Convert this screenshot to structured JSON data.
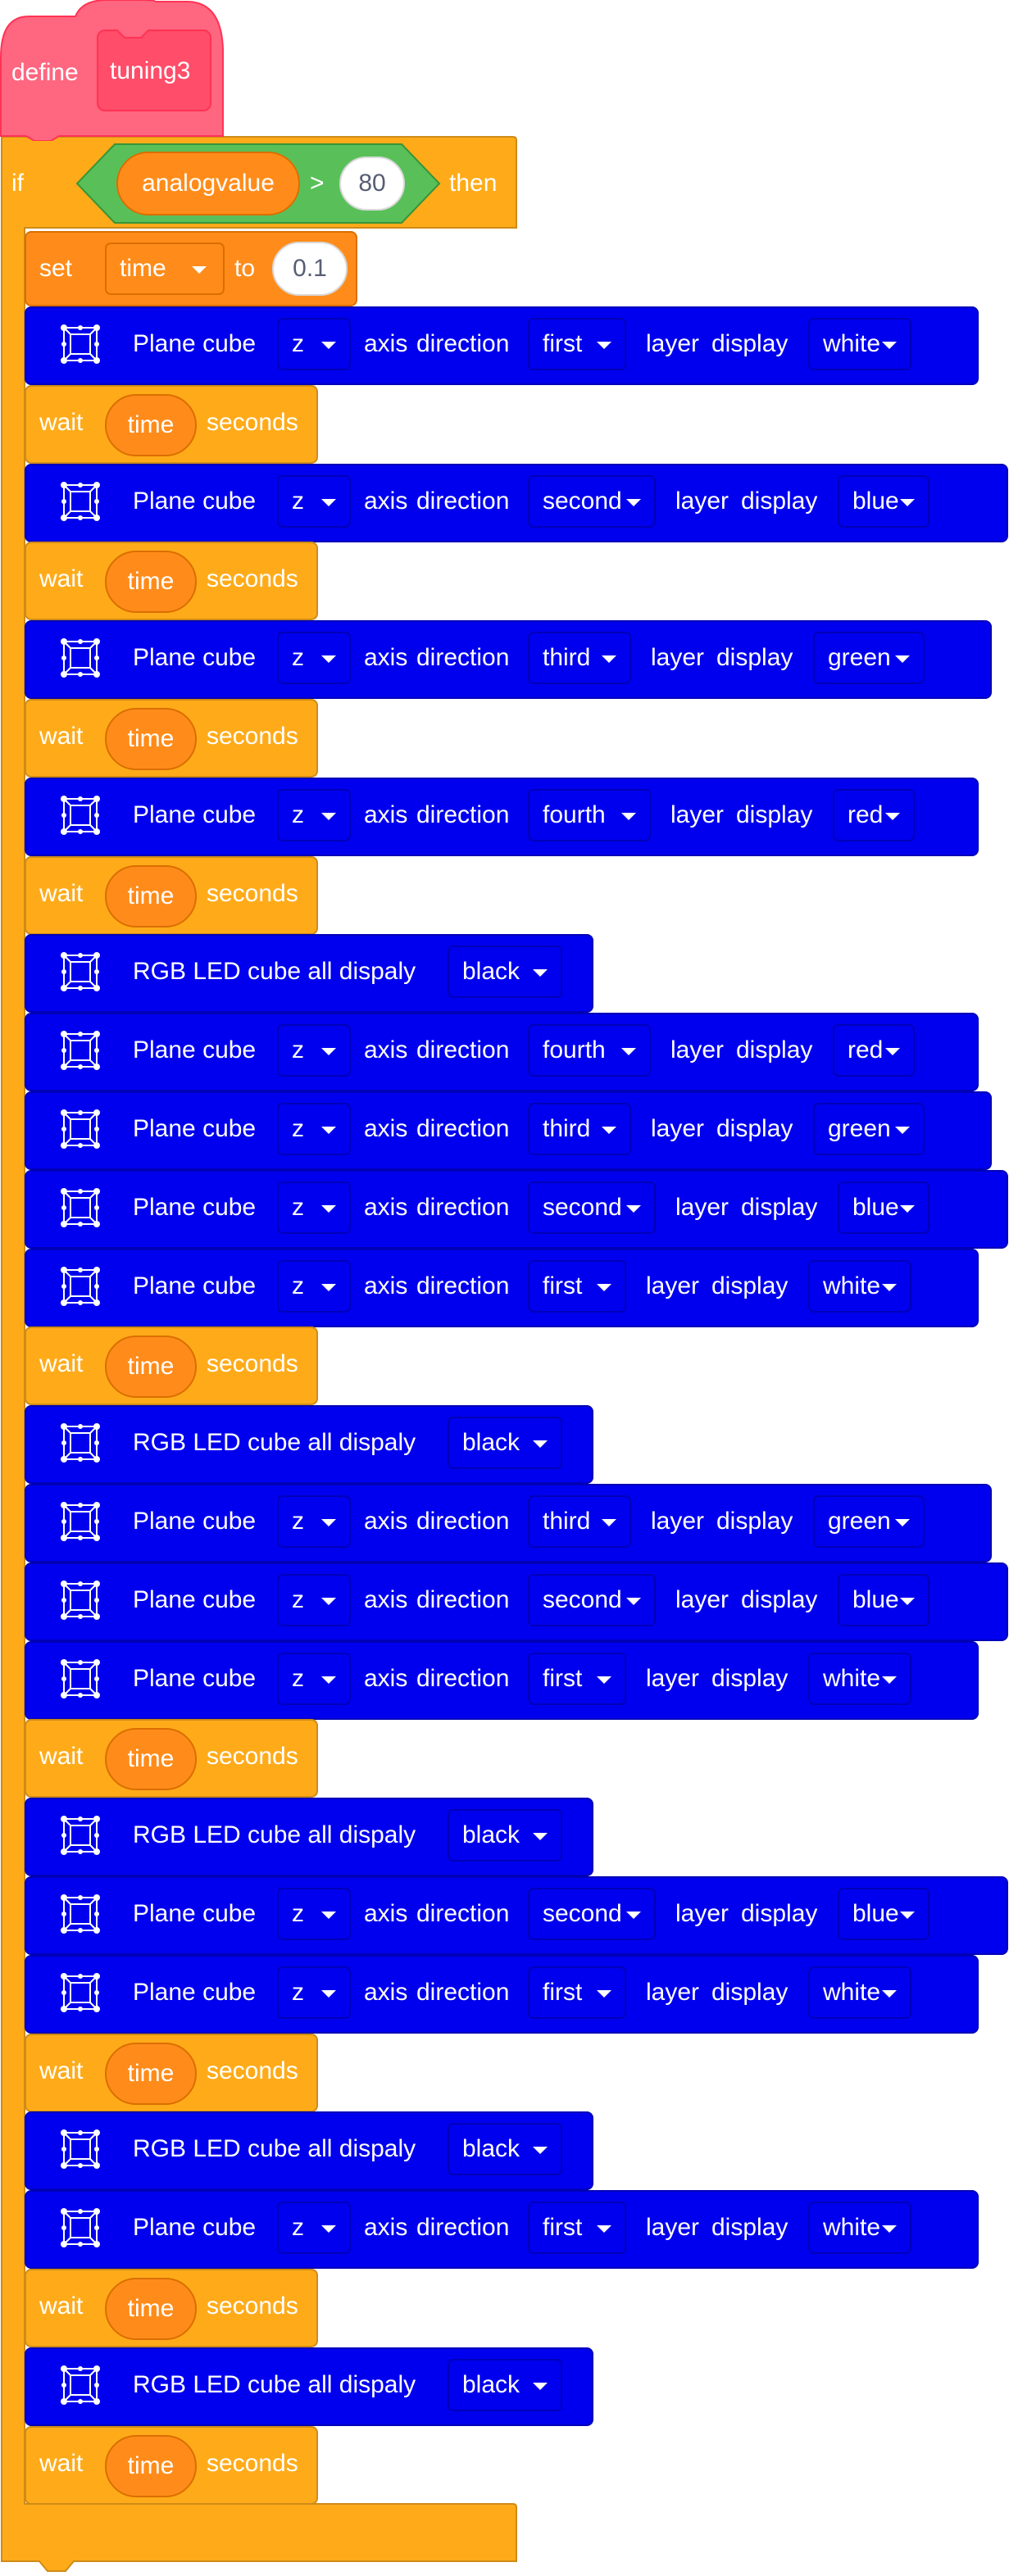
{
  "define": {
    "label": "define",
    "name": "tuning3"
  },
  "if_block": {
    "if_label": "if",
    "then_label": "then",
    "condition": {
      "variable": "analogvalue",
      "operator": ">",
      "value": "80"
    }
  },
  "set_block": {
    "set_label": "set",
    "variable": "time",
    "to_label": "to",
    "value": "0.1"
  },
  "labels": {
    "plane": "Plane cube",
    "axis": "axis",
    "direction": "direction",
    "layer": "layer",
    "display": "display",
    "rgb": "RGB LED cube all dispaly",
    "wait": "wait",
    "seconds": "seconds"
  },
  "wait_variable": "time",
  "blocks": [
    {
      "type": "plane",
      "axis": "z",
      "layer": "first",
      "color": "white"
    },
    {
      "type": "wait"
    },
    {
      "type": "plane",
      "axis": "z",
      "layer": "second",
      "color": "blue"
    },
    {
      "type": "wait"
    },
    {
      "type": "plane",
      "axis": "z",
      "layer": "third",
      "color": "green"
    },
    {
      "type": "wait"
    },
    {
      "type": "plane",
      "axis": "z",
      "layer": "fourth",
      "color": "red"
    },
    {
      "type": "wait"
    },
    {
      "type": "rgb",
      "color": "black"
    },
    {
      "type": "plane",
      "axis": "z",
      "layer": "fourth",
      "color": "red"
    },
    {
      "type": "plane",
      "axis": "z",
      "layer": "third",
      "color": "green"
    },
    {
      "type": "plane",
      "axis": "z",
      "layer": "second",
      "color": "blue"
    },
    {
      "type": "plane",
      "axis": "z",
      "layer": "first",
      "color": "white"
    },
    {
      "type": "wait"
    },
    {
      "type": "rgb",
      "color": "black"
    },
    {
      "type": "plane",
      "axis": "z",
      "layer": "third",
      "color": "green"
    },
    {
      "type": "plane",
      "axis": "z",
      "layer": "second",
      "color": "blue"
    },
    {
      "type": "plane",
      "axis": "z",
      "layer": "first",
      "color": "white"
    },
    {
      "type": "wait"
    },
    {
      "type": "rgb",
      "color": "black"
    },
    {
      "type": "plane",
      "axis": "z",
      "layer": "second",
      "color": "blue"
    },
    {
      "type": "plane",
      "axis": "z",
      "layer": "first",
      "color": "white"
    },
    {
      "type": "wait"
    },
    {
      "type": "rgb",
      "color": "black"
    },
    {
      "type": "plane",
      "axis": "z",
      "layer": "first",
      "color": "white"
    },
    {
      "type": "wait"
    },
    {
      "type": "rgb",
      "color": "black"
    },
    {
      "type": "wait"
    }
  ],
  "colors": {
    "define_fill": "#ff6680",
    "control_fill": "#ffab19",
    "variable_fill": "#ff8c1a",
    "operator_fill": "#59c059",
    "extension_fill": "#0000ee"
  }
}
